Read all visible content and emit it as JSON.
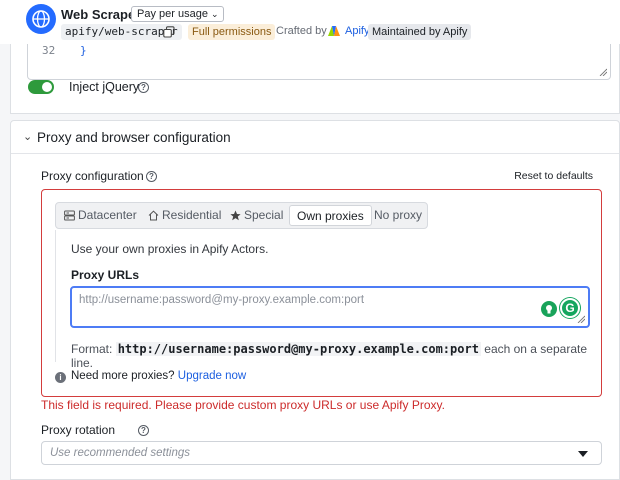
{
  "header": {
    "title": "Web Scraper",
    "pricing": "Pay per usage",
    "slug": "apify/web-scraper",
    "permissions": "Full permissions",
    "crafted_by": "Crafted by",
    "author": "Apify",
    "maintained": "Maintained by Apify"
  },
  "editor": {
    "line_number": "32",
    "code": "}"
  },
  "inject_jquery": {
    "label": "Inject jQuery",
    "enabled": true
  },
  "proxy_section": {
    "title": "Proxy and browser configuration",
    "proxy_config_label": "Proxy configuration",
    "reset": "Reset to defaults",
    "tabs": [
      {
        "label": "Datacenter",
        "icon": "server-icon"
      },
      {
        "label": "Residential",
        "icon": "home-icon"
      },
      {
        "label": "Special",
        "icon": "star-icon"
      },
      {
        "label": "Own proxies",
        "icon": ""
      },
      {
        "label": "No proxy",
        "icon": ""
      }
    ],
    "active_tab": "Own proxies",
    "own_desc": "Use your own proxies in Apify Actors.",
    "urls_label": "Proxy URLs",
    "urls_placeholder": "http://username:password@my-proxy.example.com:port",
    "format_prefix": "Format:",
    "format_code": "http://username:password@my-proxy.example.com:port",
    "format_suffix": "each on a separate line.",
    "more_text": "Need more proxies?",
    "upgrade": "Upgrade now",
    "error": "This field is required. Please provide custom proxy URLs or use Apify Proxy.",
    "rotation_label": "Proxy rotation",
    "rotation_placeholder": "Use recommended settings"
  },
  "colors": {
    "accent": "#1c5fe0",
    "toggle_on": "#2e9a3c",
    "error": "#cc2b2b",
    "focus": "#4d7cf5"
  }
}
